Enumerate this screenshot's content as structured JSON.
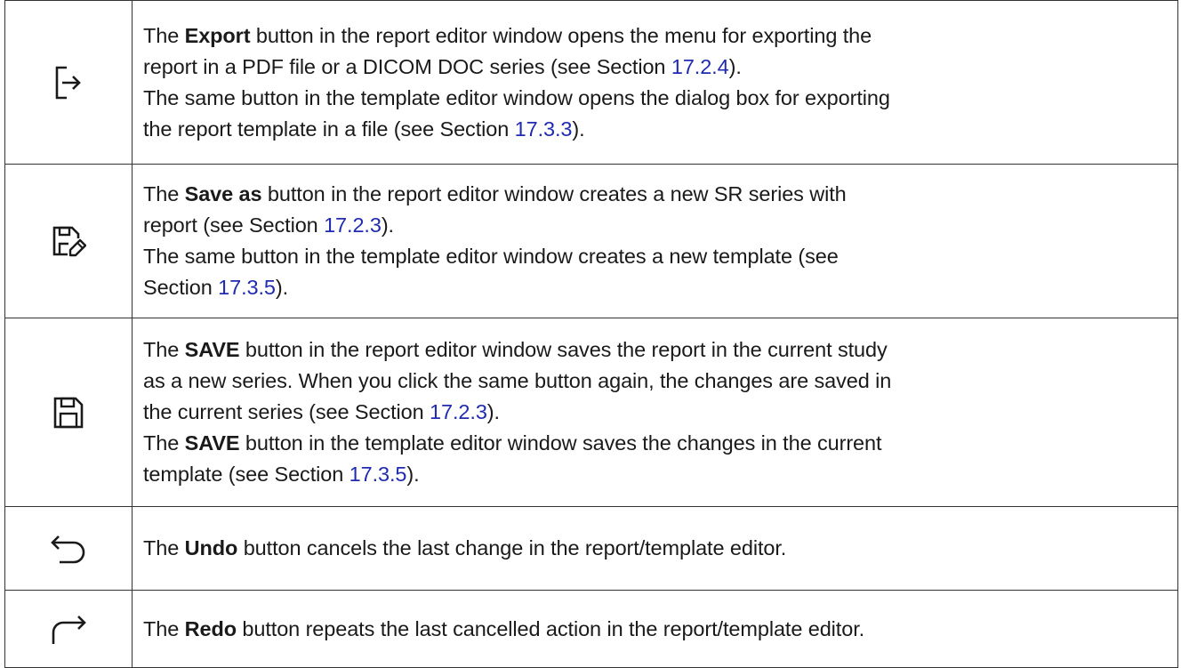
{
  "rows": [
    {
      "icon": "export-icon",
      "lines": [
        {
          "a": "The ",
          "kw": "Export",
          "b": " button in the report editor window opens the menu for exporting the"
        },
        {
          "a": "report in a PDF file or a DICOM DOC series (see Section ",
          "ref": "17.2.4",
          "b": ")."
        },
        {
          "a": "The same button in the template editor window opens the dialog box for exporting"
        },
        {
          "a": "the report template in a file (see Section ",
          "ref": "17.3.3",
          "b": ")."
        }
      ]
    },
    {
      "icon": "save-as-icon",
      "lines": [
        {
          "a": "The ",
          "kw": "Save as",
          "b": " button in the report editor window creates a new SR series with"
        },
        {
          "a": "report (see Section ",
          "ref": "17.2.3",
          "b": ")."
        },
        {
          "a": "The same button in the template editor window creates a new template (see"
        },
        {
          "a": "Section ",
          "ref": "17.3.5",
          "b": ")."
        }
      ]
    },
    {
      "icon": "save-icon",
      "lines": [
        {
          "a": "The ",
          "kw": "SAVE",
          "b": " button in the report editor window saves the report in the current study"
        },
        {
          "a": "as a new series. When you click the same button again, the changes are saved in"
        },
        {
          "a": "the current series (see Section ",
          "ref": "17.2.3",
          "b": ")."
        },
        {
          "a": "The ",
          "kw": "SAVE",
          "b": " button in the template editor window saves the changes in the current"
        },
        {
          "a": "template (see Section ",
          "ref": "17.3.5",
          "b": ")."
        }
      ]
    },
    {
      "icon": "undo-icon",
      "lines": [
        {
          "a": "The ",
          "kw": "Undo",
          "b": " button cancels the last change in the report/template editor."
        }
      ]
    },
    {
      "icon": "redo-icon",
      "lines": [
        {
          "a": "The ",
          "kw": "Redo",
          "b": " button repeats the last cancelled action in the report/template editor."
        }
      ]
    }
  ],
  "colors": {
    "link": "#1f2bb0",
    "border": "#333333",
    "text": "#1a1a1a"
  }
}
